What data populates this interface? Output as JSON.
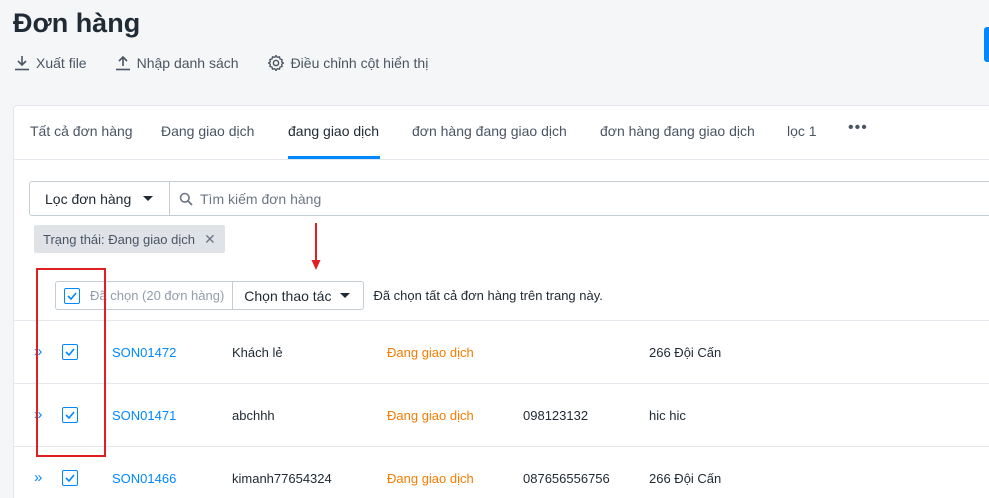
{
  "page": {
    "title": "Đơn hàng"
  },
  "toolbar": {
    "export_label": "Xuất file",
    "import_label": "Nhập danh sách",
    "columns_label": "Điều chỉnh cột hiển thị"
  },
  "tabs": [
    {
      "label": "Tất cả đơn hàng"
    },
    {
      "label": "Đang giao dịch"
    },
    {
      "label": "đang giao dịch"
    },
    {
      "label": "đơn hàng đang giao dịch"
    },
    {
      "label": "đơn hàng đang giao dịch"
    },
    {
      "label": "lọc 1"
    }
  ],
  "tabs_more": "•••",
  "filter": {
    "button_label": "Lọc đơn hàng",
    "search_placeholder": "Tìm kiếm đơn hàng",
    "active_chip": "Trạng thái: Đang giao dịch"
  },
  "bulk": {
    "selected_label": "Đã chọn (20 đơn hàng)",
    "action_label": "Chọn thao tác",
    "note": "Đã chọn tất cả đơn hàng trên trang này."
  },
  "orders": [
    {
      "code": "SON01472",
      "customer": "Khách lẻ",
      "status": "Đang giao dịch",
      "phone": "",
      "address": "266 Đội Cấn"
    },
    {
      "code": "SON01471",
      "customer": "abchhh",
      "status": "Đang giao dịch",
      "phone": "098123132",
      "address": "hic hic"
    },
    {
      "code": "SON01466",
      "customer": "kimanh77654324",
      "status": "Đang giao dịch",
      "phone": "087656556756",
      "address": "266 Đội Cấn"
    }
  ],
  "colors": {
    "accent": "#0088ff",
    "status_orange": "#f57c00",
    "annotation_red": "#e02020"
  },
  "icons": {
    "export": "download-icon",
    "import": "upload-icon",
    "columns": "gear-icon",
    "search": "search-icon",
    "expand": "double-chevron-right-icon"
  }
}
